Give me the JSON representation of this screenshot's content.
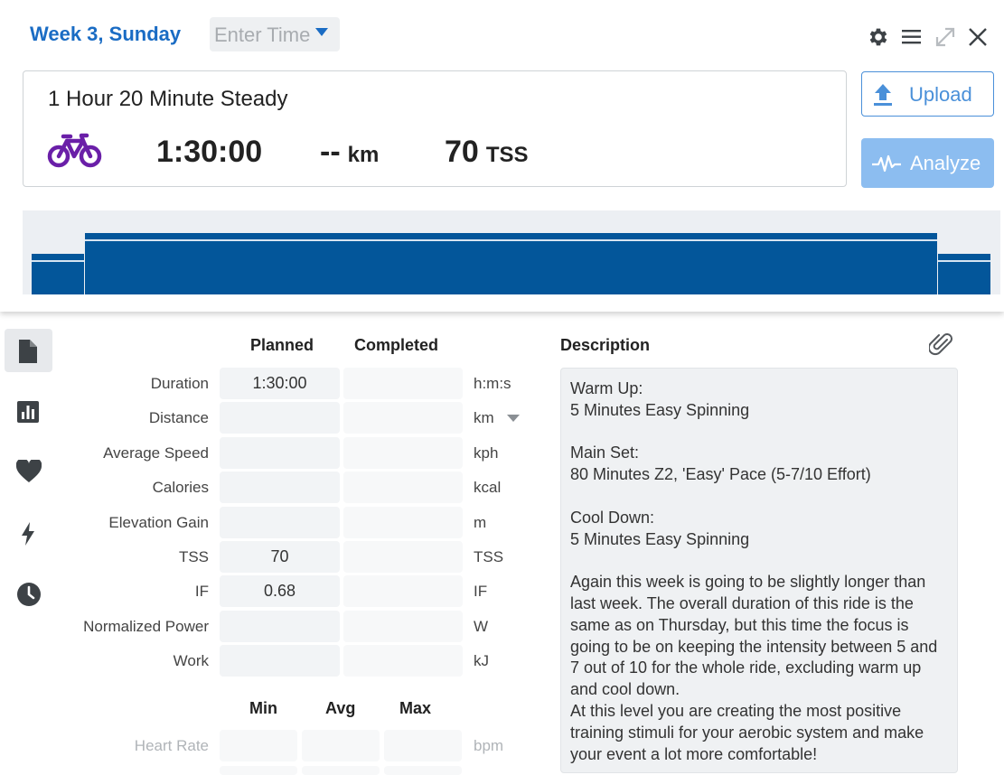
{
  "header": {
    "date_title": "Week 3, Sunday",
    "time_select": {
      "value": "Enter Time"
    },
    "window_icons": [
      "gear-icon",
      "menu-icon",
      "expand-icon",
      "close-icon"
    ]
  },
  "summary": {
    "title": "1 Hour 20 Minute Steady",
    "sport_icon": "bike-icon",
    "duration": "1:30:00",
    "distance_value": "--",
    "distance_unit": "km",
    "tss_value": "70",
    "tss_unit": "TSS"
  },
  "actions": {
    "upload_label": "Upload",
    "analyze_label": "Analyze"
  },
  "workout_chart": {
    "type": "area",
    "segments": [
      {
        "name": "Warm Up",
        "minutes": 5
      },
      {
        "name": "Main Set",
        "minutes": 80
      },
      {
        "name": "Cool Down",
        "minutes": 5
      }
    ],
    "colors": {
      "bar": "#03569a",
      "band": "#3e78b2",
      "background": "#eceff3"
    }
  },
  "sidebar": {
    "items": [
      {
        "icon": "document-icon",
        "active": true
      },
      {
        "icon": "bar-chart-icon",
        "active": false
      },
      {
        "icon": "heart-icon",
        "active": false
      },
      {
        "icon": "lightning-icon",
        "active": false
      },
      {
        "icon": "clock-icon",
        "active": false
      }
    ]
  },
  "metrics": {
    "col_planned": "Planned",
    "col_completed": "Completed",
    "rows": [
      {
        "label": "Duration",
        "planned": "1:30:00",
        "completed": "",
        "unit": "h:m:s"
      },
      {
        "label": "Distance",
        "planned": "",
        "completed": "",
        "unit": "km"
      },
      {
        "label": "Average Speed",
        "planned": "",
        "completed": "",
        "unit": "kph"
      },
      {
        "label": "Calories",
        "planned": "",
        "completed": "",
        "unit": "kcal"
      },
      {
        "label": "Elevation Gain",
        "planned": "",
        "completed": "",
        "unit": "m"
      },
      {
        "label": "TSS",
        "planned": "70",
        "completed": "",
        "unit": "TSS"
      },
      {
        "label": "IF",
        "planned": "0.68",
        "completed": "",
        "unit": "IF"
      },
      {
        "label": "Normalized Power",
        "planned": "",
        "completed": "",
        "unit": "W"
      },
      {
        "label": "Work",
        "planned": "",
        "completed": "",
        "unit": "kJ"
      }
    ]
  },
  "ranges": {
    "col_min": "Min",
    "col_avg": "Avg",
    "col_max": "Max",
    "rows": [
      {
        "label": "Heart Rate",
        "unit": "bpm"
      }
    ]
  },
  "description": {
    "title": "Description",
    "text": "Warm Up:\n5 Minutes Easy Spinning\n\nMain Set:\n80 Minutes Z2, 'Easy' Pace (5-7/10 Effort)\n\nCool Down:\n5 Minutes Easy Spinning\n\nAgain this week is going to be slightly longer than last week. The overall duration of this ride is the same as on Thursday, but this time the focus is going to be on keeping the intensity between 5 and 7 out of 10 for the whole ride, excluding warm up and cool down.\nAt this level you are creating the most positive training stimuli for your aerobic system and make your event a lot more comfortable!"
  }
}
